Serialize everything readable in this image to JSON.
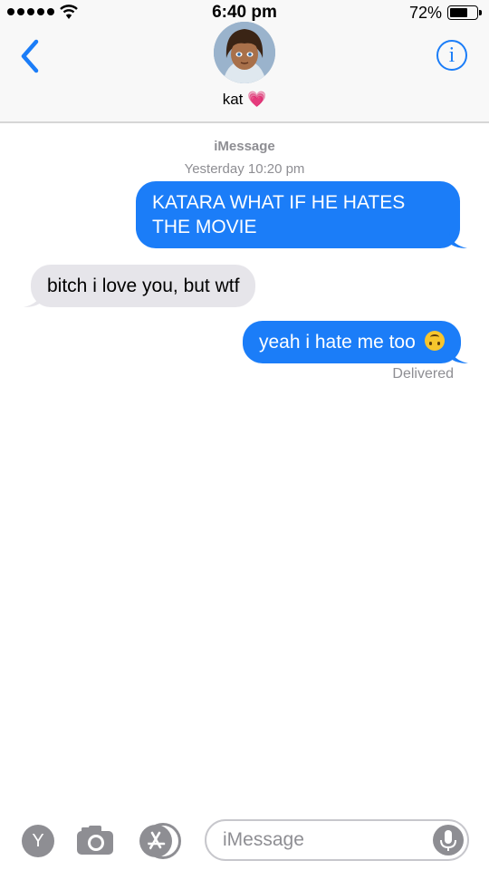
{
  "status_bar": {
    "time": "6:40 pm",
    "battery_percent": "72%",
    "battery_level": 0.72
  },
  "header": {
    "contact_name": "kat 💗",
    "info_label": "i"
  },
  "conversation": {
    "service": "iMessage",
    "timestamp": "Yesterday 10:20 pm",
    "messages": [
      {
        "direction": "sent",
        "text": "KATARA WHAT IF HE HATES THE MOVIE"
      },
      {
        "direction": "received",
        "text": "bitch i love you, but wtf"
      },
      {
        "direction": "sent",
        "text": "yeah i hate me too"
      }
    ],
    "delivery_status": "Delivered"
  },
  "compose_bar": {
    "placeholder": "iMessage",
    "y_label": "Y",
    "icons": [
      "y-icon",
      "camera-icon",
      "app-store-icon",
      "microphone-icon"
    ]
  },
  "colors": {
    "accent": "#1b7df8",
    "sent_bubble": "#1b7df8",
    "received_bubble": "#e6e5ea",
    "meta_text": "#8e8e93"
  }
}
